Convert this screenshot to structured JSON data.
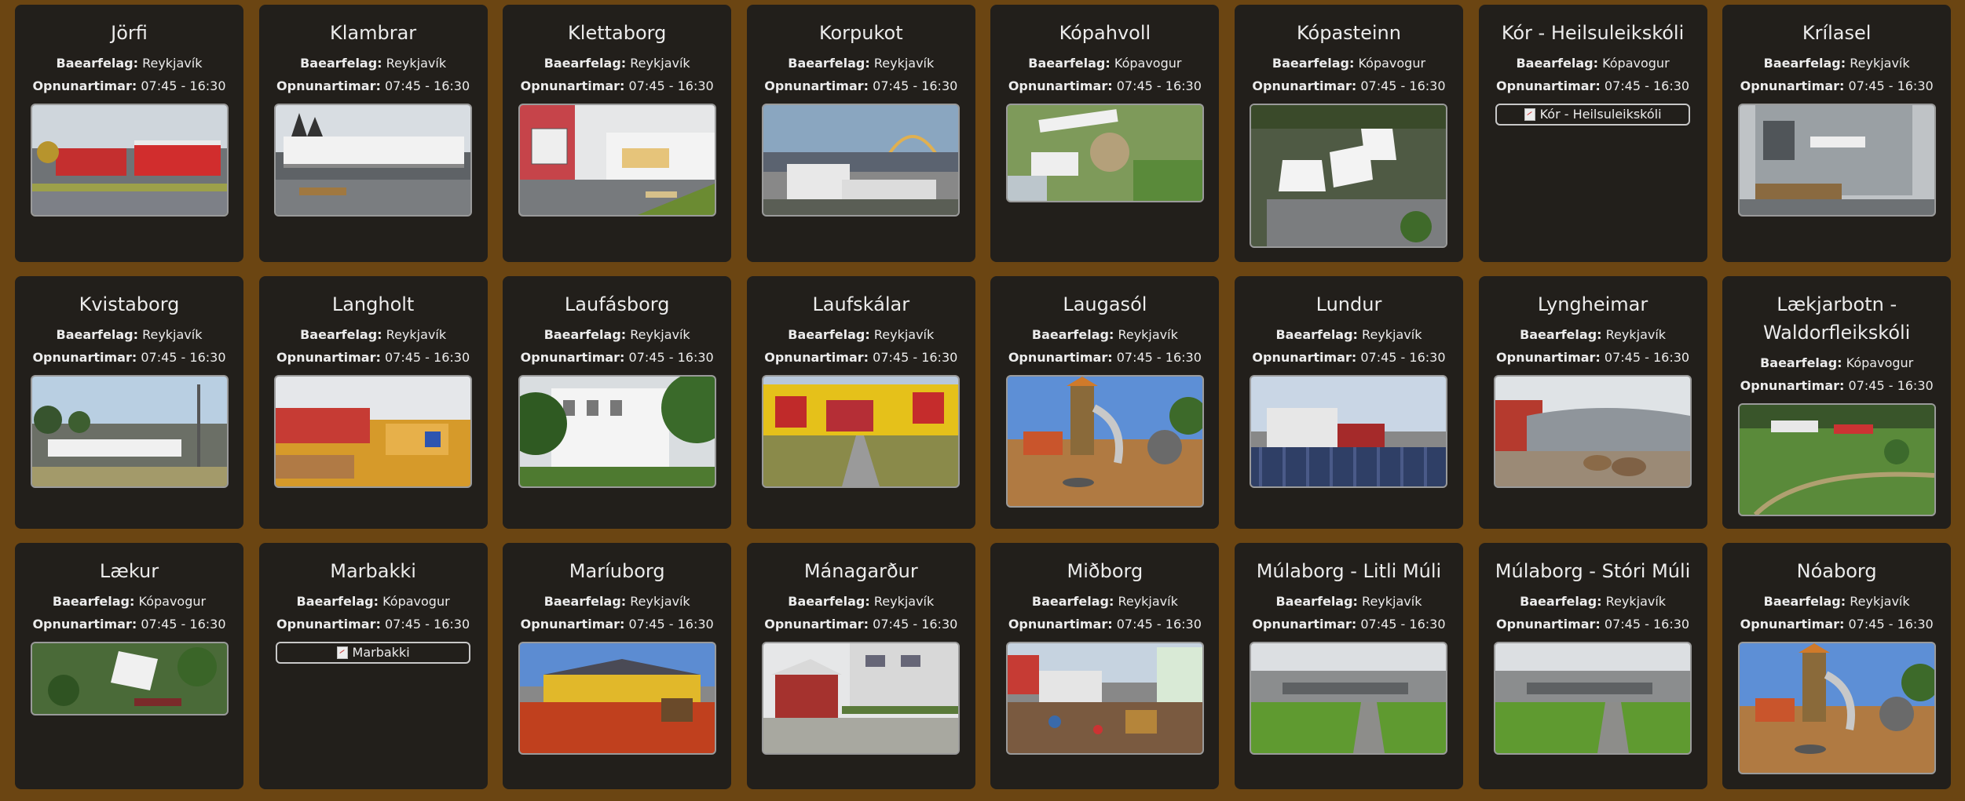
{
  "labels": {
    "municipality": "Baearfelag:",
    "hours": "Opnunartimar:"
  },
  "cards": [
    {
      "name": "Jörfi",
      "municipality": "Reykjavík",
      "hours": "07:45 - 16:30",
      "image": "photo",
      "scene": "red-building-parking"
    },
    {
      "name": "Klambrar",
      "municipality": "Reykjavík",
      "hours": "07:45 - 16:30",
      "image": "photo",
      "scene": "white-building-church"
    },
    {
      "name": "Klettaborg",
      "municipality": "Reykjavík",
      "hours": "07:45 - 16:30",
      "image": "photo",
      "scene": "red-white-building-path"
    },
    {
      "name": "Korpukot",
      "municipality": "Reykjavík",
      "hours": "07:45 - 16:30",
      "image": "photo",
      "scene": "buildings-rainbow-sky"
    },
    {
      "name": "Kópahvoll",
      "municipality": "Kópavogur",
      "hours": "07:45 - 16:30",
      "image": "photo",
      "scene": "aerial-green-playground"
    },
    {
      "name": "Kópasteinn",
      "municipality": "Kópavogur",
      "hours": "07:45 - 16:30",
      "image": "photo",
      "scene": "aerial-white-roofs"
    },
    {
      "name": "Kór - Heilsuleikskóli",
      "municipality": "Kópavogur",
      "hours": "07:45 - 16:30",
      "image": "broken",
      "alt": "Kór - Heilsuleikskóli"
    },
    {
      "name": "Krílasel",
      "municipality": "Reykjavík",
      "hours": "07:45 - 16:30",
      "image": "photo",
      "scene": "grey-building-sign"
    },
    {
      "name": "Kvistaborg",
      "municipality": "Reykjavík",
      "hours": "07:45 - 16:30",
      "image": "photo",
      "scene": "low-building-lamp"
    },
    {
      "name": "Langholt",
      "municipality": "Reykjavík",
      "hours": "07:45 - 16:30",
      "image": "photo",
      "scene": "sandbox-yellow-playground"
    },
    {
      "name": "Laufásborg",
      "municipality": "Reykjavík",
      "hours": "07:45 - 16:30",
      "image": "photo",
      "scene": "white-building-trees"
    },
    {
      "name": "Laufskálar",
      "municipality": "Reykjavík",
      "hours": "07:45 - 16:30",
      "image": "photo",
      "scene": "yellow-building-walkway"
    },
    {
      "name": "Laugasól",
      "municipality": "Reykjavík",
      "hours": "07:45 - 16:30",
      "image": "photo",
      "scene": "playground-tower"
    },
    {
      "name": "Lundur",
      "municipality": "Reykjavík",
      "hours": "07:45 - 16:30",
      "image": "photo",
      "scene": "white-house-fence"
    },
    {
      "name": "Lyngheimar",
      "municipality": "Reykjavík",
      "hours": "07:45 - 16:30",
      "image": "photo",
      "scene": "curved-building-rocks"
    },
    {
      "name": "Lækjarbotn - Waldorfleikskóli",
      "municipality": "Kópavogur",
      "hours": "07:45 - 16:30",
      "image": "photo",
      "scene": "aerial-green-garden"
    },
    {
      "name": "Lækur",
      "municipality": "Kópavogur",
      "hours": "07:45 - 16:30",
      "image": "photo",
      "scene": "aerial-white-house-trees"
    },
    {
      "name": "Marbakki",
      "municipality": "Kópavogur",
      "hours": "07:45 - 16:30",
      "image": "broken",
      "alt": "Marbakki"
    },
    {
      "name": "Maríuborg",
      "municipality": "Reykjavík",
      "hours": "07:45 - 16:30",
      "image": "photo",
      "scene": "yellow-building-red-ground"
    },
    {
      "name": "Mánagarður",
      "municipality": "Reykjavík",
      "hours": "07:45 - 16:30",
      "image": "photo",
      "scene": "red-house-apartments"
    },
    {
      "name": "Miðborg",
      "municipality": "Reykjavík",
      "hours": "07:45 - 16:30",
      "image": "photo",
      "scene": "colorful-playground-houses"
    },
    {
      "name": "Múlaborg - Litli Múli",
      "municipality": "Reykjavík",
      "hours": "07:45 - 16:30",
      "image": "photo",
      "scene": "grey-building-lawn"
    },
    {
      "name": "Múlaborg - Stóri Múli",
      "municipality": "Reykjavík",
      "hours": "07:45 - 16:30",
      "image": "photo",
      "scene": "grey-building-lawn"
    },
    {
      "name": "Nóaborg",
      "municipality": "Reykjavík",
      "hours": "07:45 - 16:30",
      "image": "photo",
      "scene": "playground-tower"
    }
  ]
}
